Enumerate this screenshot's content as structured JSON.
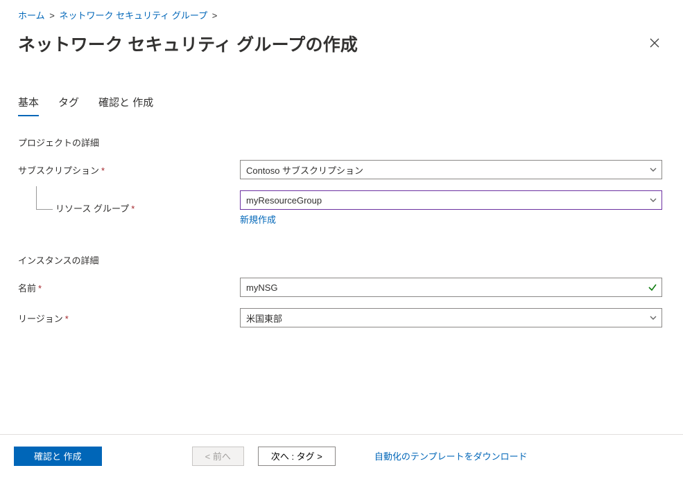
{
  "breadcrumb": {
    "home": "ホーム",
    "sep": ">",
    "nsg": "ネットワーク セキュリティ グループ"
  },
  "header": {
    "title": "ネットワーク セキュリティ グループの作成"
  },
  "tabs": {
    "basic": "基本",
    "tags": "タグ",
    "review": "確認と 作成"
  },
  "form": {
    "project_section": "プロジェクトの詳細",
    "subscription_label": "サブスクリプション",
    "subscription_value": "Contoso サブスクリプション",
    "resource_group_label": "リソース グループ",
    "resource_group_value": "myResourceGroup",
    "create_new": "新規作成",
    "instance_section": "インスタンスの詳細",
    "name_label": "名前",
    "name_value": "myNSG",
    "region_label": "リージョン",
    "region_value": "米国東部",
    "required_marker": "*"
  },
  "footer": {
    "review_create": "確認と 作成",
    "previous": "< 前へ",
    "next": "次へ : タグ >",
    "download_template": "自動化のテンプレートをダウンロード"
  }
}
